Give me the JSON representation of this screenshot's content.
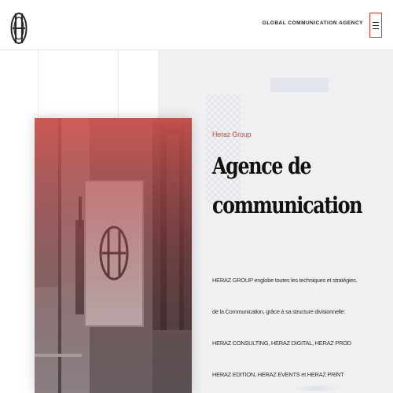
{
  "header": {
    "tagline": "GLOBAL COMMUNICATION AGENCY",
    "logo_icon": "heraz-monogram-icon",
    "menu_icon": "hamburger-menu-icon",
    "menu_border_color": "#e8402a"
  },
  "hero": {
    "kicker": "Heraz Group",
    "title_line1": "Agence de",
    "title_line2": "communication",
    "paragraphs": [
      "HERAZ GROUP englobe toutes les techniques et stratégies.",
      "de la Communication, grâce à sa structure divisionnelle:",
      "HERAZ CONSULTING, HERAZ DIGITAL, HERAZ PROD",
      "HERAZ EDITION, HERAZ EVENTS et HERAZ PRINT"
    ],
    "accent_color": "#e8402a"
  }
}
